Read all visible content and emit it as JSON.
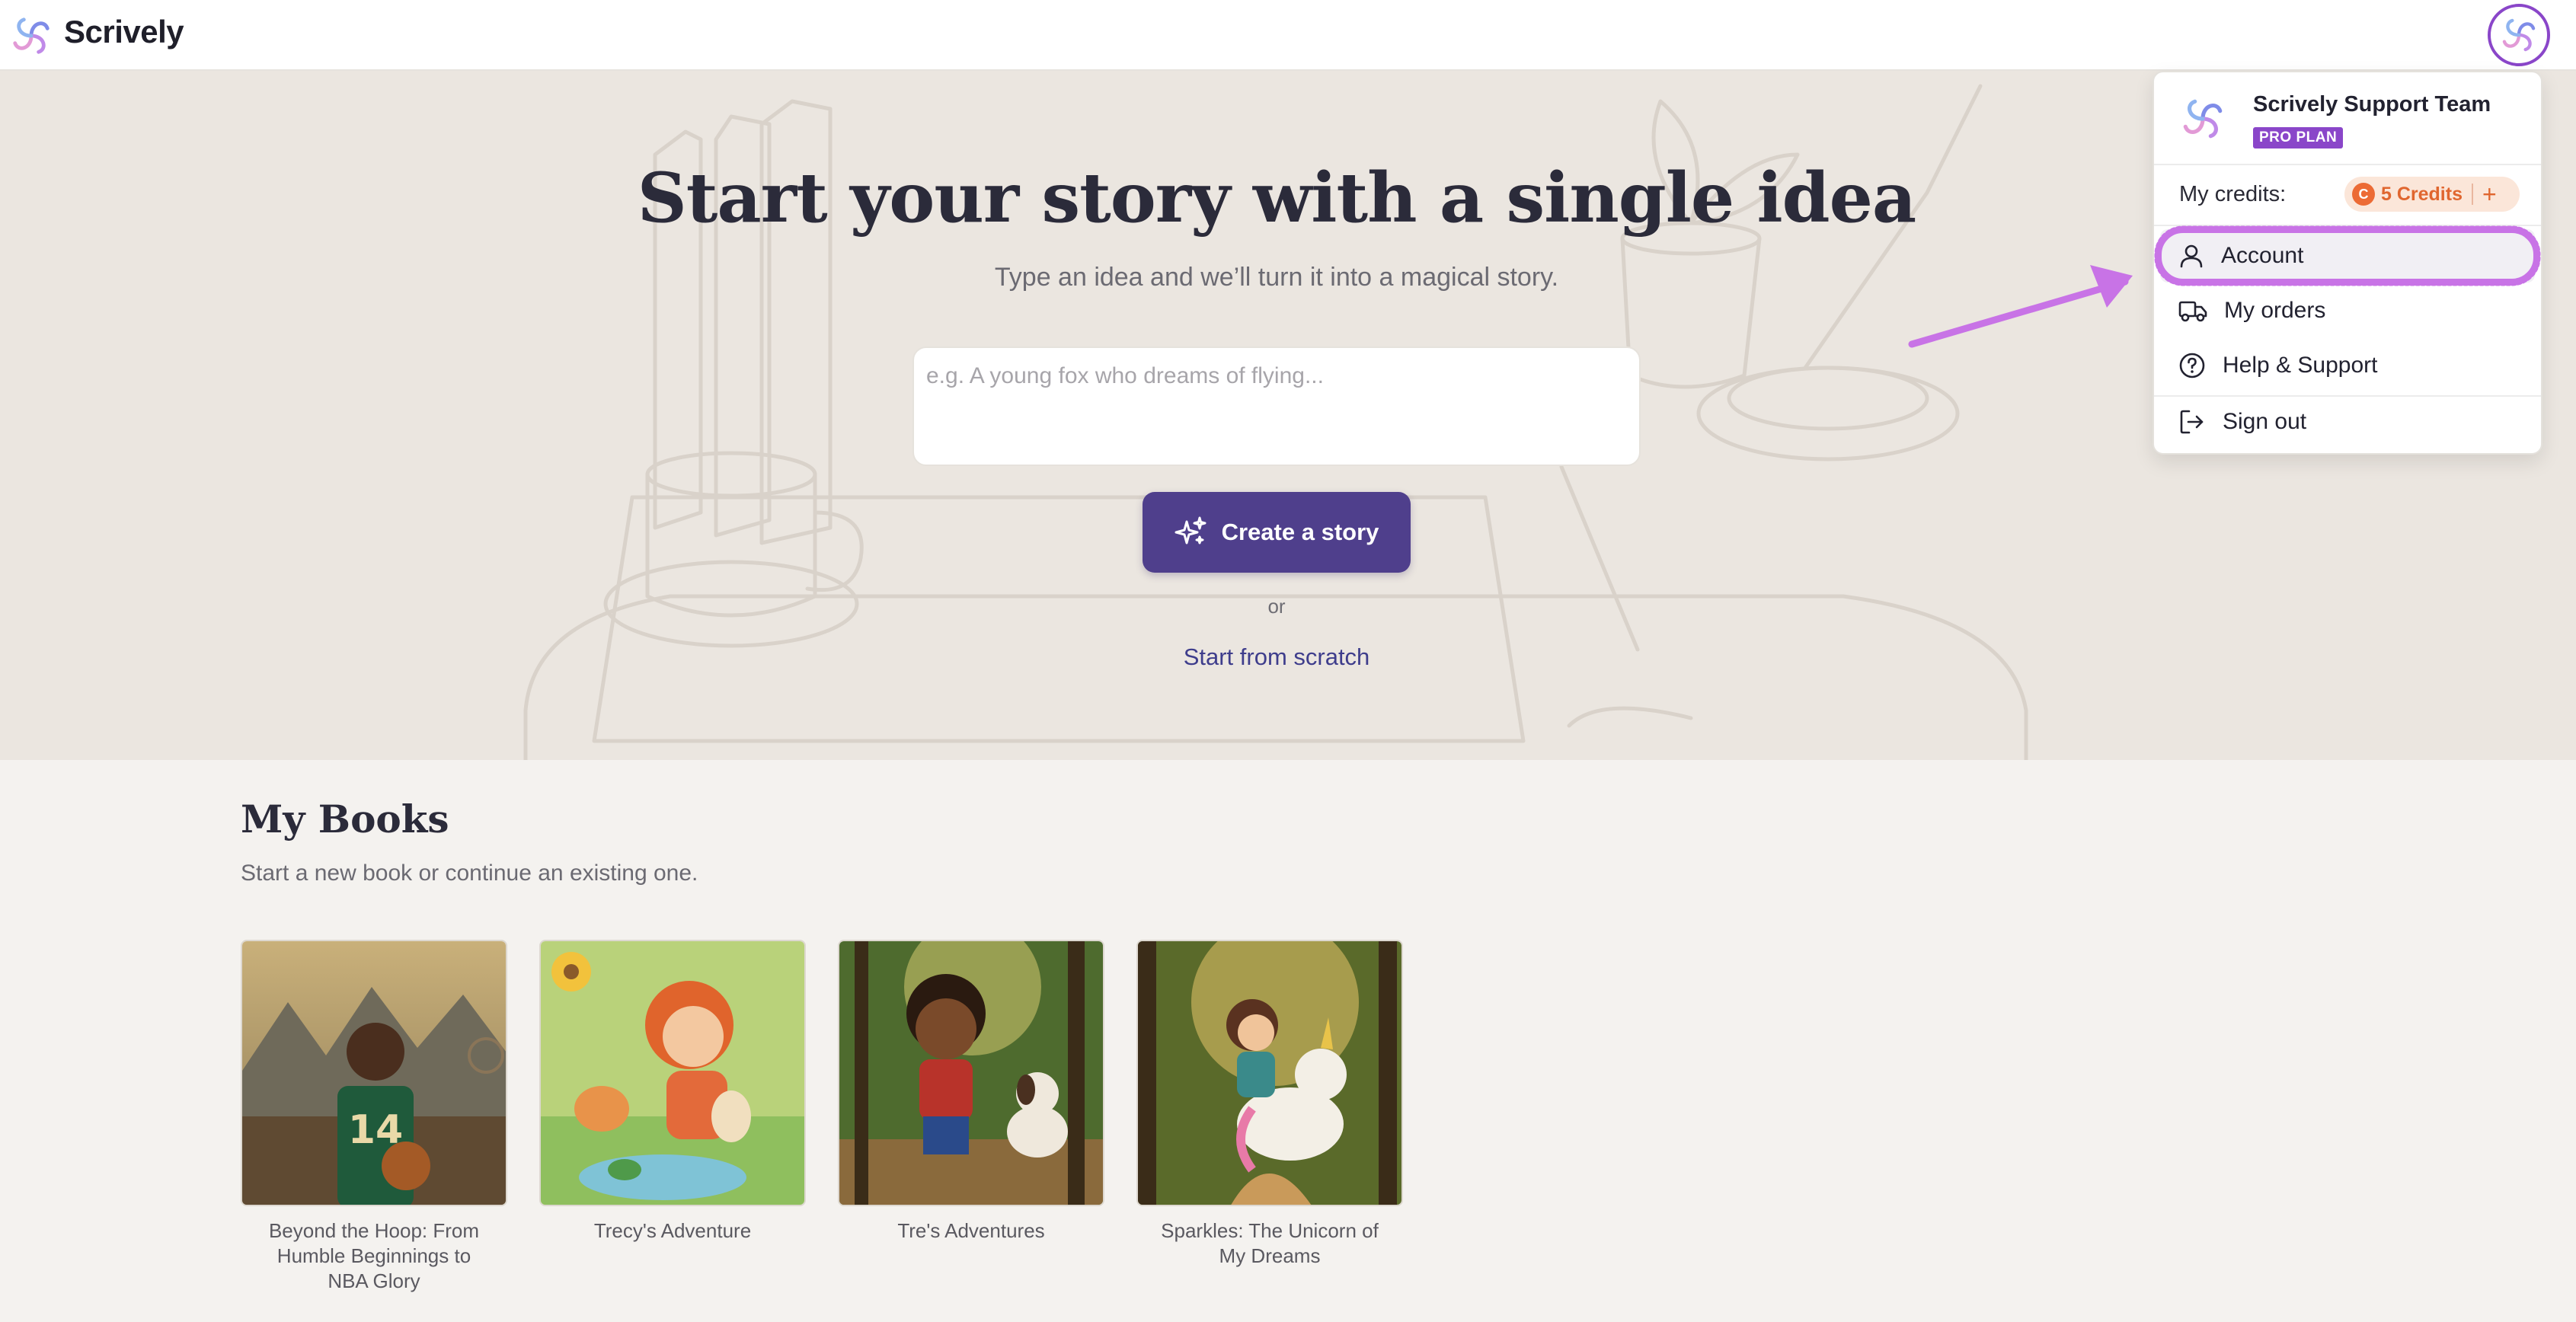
{
  "header": {
    "brand": "Scrively",
    "logo_icon": "scrively-swirl-logo",
    "avatar_icon": "scrively-swirl-avatar"
  },
  "hero": {
    "title": "Start your story with a single idea",
    "subtitle": "Type an idea and we’ll turn it into a magical story.",
    "input_placeholder": "e.g. A young fox who dreams of flying...",
    "input_value": "",
    "create_label": "Create a story",
    "create_icon": "sparkles-icon",
    "or_text": "or",
    "scratch_label": "Start from scratch"
  },
  "books": {
    "title": "My Books",
    "subtitle": "Start a new book or continue an existing one.",
    "items": [
      {
        "title": "Beyond the Hoop: From Humble Beginnings to NBA Glory",
        "jersey": "14"
      },
      {
        "title": "Trecy's Adventure"
      },
      {
        "title": "Tre's Adventures"
      },
      {
        "title": "Sparkles: The Unicorn of My Dreams"
      }
    ]
  },
  "menu": {
    "user_name": "Scrively Support Team",
    "plan_badge": "PRO PLAN",
    "credits_label": "My credits:",
    "credits_coin": "C",
    "credits_value": "5 Credits",
    "credits_add": "+",
    "items": [
      {
        "label": "Account",
        "icon": "user-icon",
        "highlighted": true
      },
      {
        "label": "My orders",
        "icon": "truck-icon"
      },
      {
        "label": "Help & Support",
        "icon": "help-circle-icon"
      },
      {
        "label": "Sign out",
        "icon": "sign-out-icon"
      }
    ]
  },
  "colors": {
    "brand_purple": "#4f3f8c",
    "badge_purple": "#8a46c9",
    "credits_orange": "#e0662f",
    "annotation_magenta": "#c873e6",
    "hero_background": "#ebe6e0"
  }
}
